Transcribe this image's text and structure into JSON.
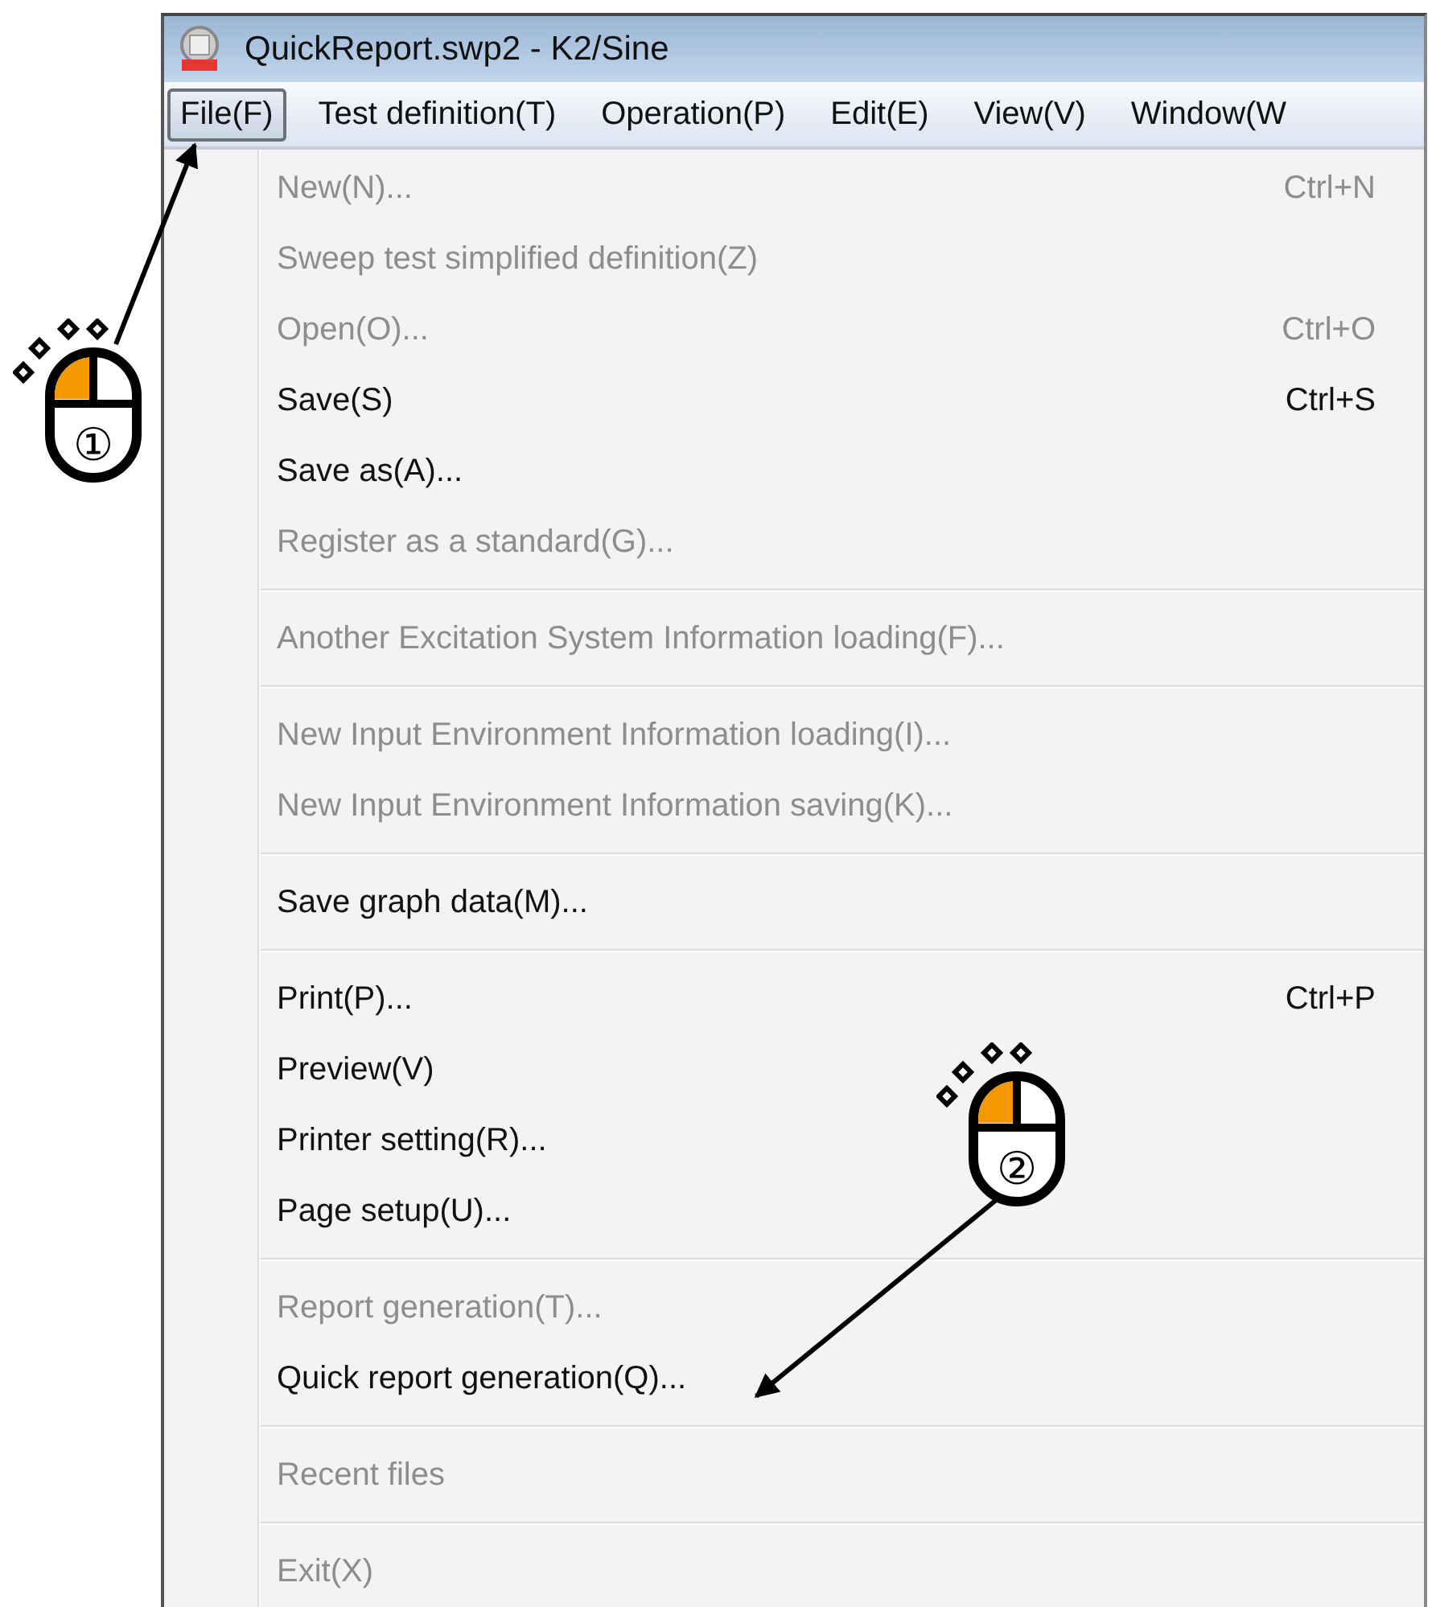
{
  "window": {
    "title": "QuickReport.swp2 - K2/Sine"
  },
  "menu_bar": [
    {
      "label": "File(F)",
      "selected": true
    },
    {
      "label": "Test definition(T)",
      "selected": false
    },
    {
      "label": "Operation(P)",
      "selected": false
    },
    {
      "label": "Edit(E)",
      "selected": false
    },
    {
      "label": "View(V)",
      "selected": false
    },
    {
      "label": "Window(W",
      "selected": false
    }
  ],
  "menu": [
    {
      "kind": "item",
      "label": "New(N)...",
      "shortcut": "Ctrl+N",
      "disabled": true
    },
    {
      "kind": "item",
      "label": "Sweep test simplified definition(Z)",
      "disabled": true
    },
    {
      "kind": "item",
      "label": "Open(O)...",
      "shortcut": "Ctrl+O",
      "disabled": true
    },
    {
      "kind": "item",
      "label": "Save(S)",
      "shortcut": "Ctrl+S",
      "disabled": false
    },
    {
      "kind": "item",
      "label": "Save as(A)...",
      "disabled": false
    },
    {
      "kind": "item",
      "label": "Register as a standard(G)...",
      "disabled": true
    },
    {
      "kind": "separator"
    },
    {
      "kind": "item",
      "label": "Another Excitation System Information loading(F)...",
      "disabled": true
    },
    {
      "kind": "separator"
    },
    {
      "kind": "item",
      "label": "New Input Environment Information loading(I)...",
      "disabled": true
    },
    {
      "kind": "item",
      "label": "New Input Environment Information saving(K)...",
      "disabled": true
    },
    {
      "kind": "separator"
    },
    {
      "kind": "item",
      "label": "Save graph data(M)...",
      "disabled": false
    },
    {
      "kind": "separator"
    },
    {
      "kind": "item",
      "label": "Print(P)...",
      "shortcut": "Ctrl+P",
      "disabled": false
    },
    {
      "kind": "item",
      "label": "Preview(V)",
      "disabled": false
    },
    {
      "kind": "item",
      "label": "Printer setting(R)...",
      "disabled": false
    },
    {
      "kind": "item",
      "label": "Page setup(U)...",
      "disabled": false
    },
    {
      "kind": "separator"
    },
    {
      "kind": "item",
      "label": "Report generation(T)...",
      "disabled": true
    },
    {
      "kind": "item",
      "label": "Quick report generation(Q)...",
      "disabled": false
    },
    {
      "kind": "separator"
    },
    {
      "kind": "item",
      "label": "Recent files",
      "disabled": true
    },
    {
      "kind": "separator"
    },
    {
      "kind": "item",
      "label": "Exit(X)",
      "disabled": true
    }
  ],
  "annotations": [
    {
      "label": "①"
    },
    {
      "label": "②"
    }
  ]
}
